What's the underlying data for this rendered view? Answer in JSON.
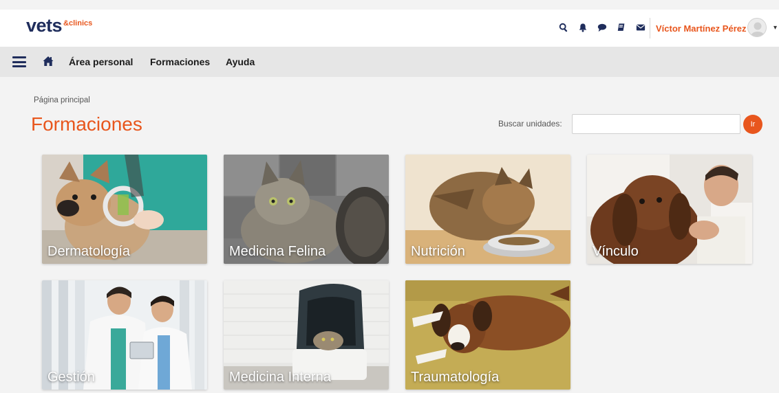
{
  "brand": {
    "main": "vets",
    "sub": "&clinics"
  },
  "header": {
    "icons": [
      "search-icon",
      "bell-icon",
      "chat-icon",
      "book-icon",
      "envelope-icon"
    ],
    "user_name": "Víctor Martínez Pérez"
  },
  "nav": {
    "items": [
      {
        "label": "Área personal"
      },
      {
        "label": "Formaciones"
      },
      {
        "label": "Ayuda"
      }
    ]
  },
  "breadcrumb": "Página principal",
  "page_title": "Formaciones",
  "search": {
    "label": "Buscar unidades:",
    "value": "",
    "button_label": "Ir"
  },
  "courses": [
    {
      "label": "Dermatología"
    },
    {
      "label": "Medicina Felina"
    },
    {
      "label": "Nutrición"
    },
    {
      "label": "Vínculo"
    },
    {
      "label": "Gestión"
    },
    {
      "label": "Medicina Interna"
    },
    {
      "label": "Traumatología"
    }
  ],
  "colors": {
    "accent": "#e8561d",
    "brand_navy": "#1f2d5c",
    "nav_bg": "#e6e6e6"
  }
}
